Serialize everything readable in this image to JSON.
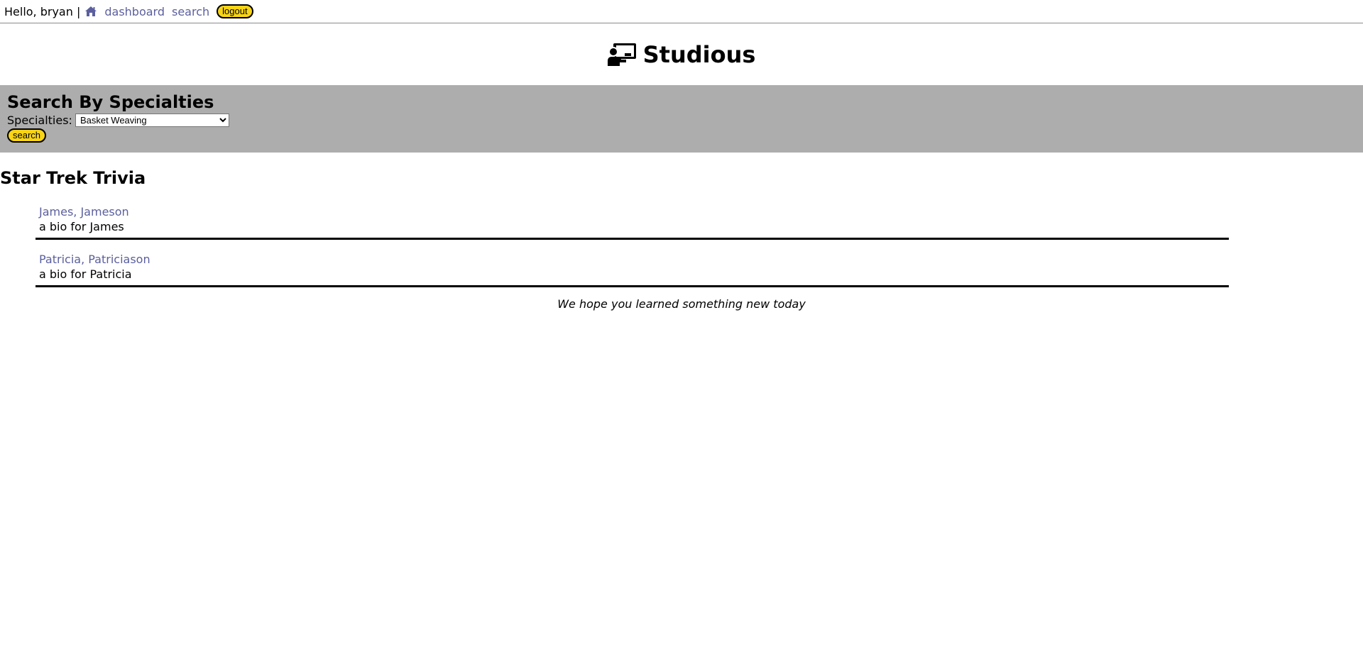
{
  "header": {
    "greeting": "Hello, bryan |",
    "home_icon": "home-icon",
    "nav": [
      "dashboard",
      "search"
    ],
    "logout_label": "logout"
  },
  "brand": {
    "logo_icon": "chalkboard-teacher-icon",
    "title": "Studious"
  },
  "search_panel": {
    "heading": "Search By Specialties",
    "label": "Specialties:",
    "selected": "Basket Weaving",
    "button_label": "search"
  },
  "results": {
    "heading": "Star Trek Trivia",
    "items": [
      {
        "name": "James, Jameson",
        "bio": "a bio for James"
      },
      {
        "name": "Patricia, Patriciason",
        "bio": "a bio for Patricia"
      }
    ]
  },
  "footer": {
    "note": "We hope you learned something new today"
  },
  "colors": {
    "accent_button": "#f7d417",
    "link": "#5b5f9e",
    "panel": "#adadad"
  }
}
